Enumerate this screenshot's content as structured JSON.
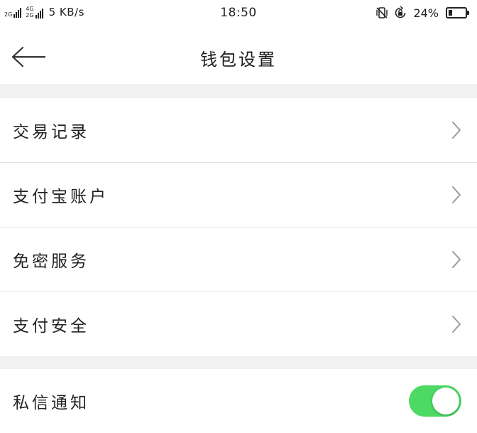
{
  "status_bar": {
    "signal_1_label": "2G",
    "signal_2_label_top": "4G",
    "signal_2_label_bottom": "2G",
    "network_speed": "5 KB/s",
    "time": "18:50",
    "battery_percent": "24%",
    "battery_level": 0.24,
    "icons": [
      "vibrate-off-icon",
      "rotation-lock-icon",
      "battery-icon"
    ]
  },
  "header": {
    "back_icon": "back-arrow-icon",
    "title": "钱包设置"
  },
  "menu_group_1": {
    "items": [
      {
        "label": "交易记录",
        "icon": "chevron-right-icon"
      },
      {
        "label": "支付宝账户",
        "icon": "chevron-right-icon"
      },
      {
        "label": "免密服务",
        "icon": "chevron-right-icon"
      },
      {
        "label": "支付安全",
        "icon": "chevron-right-icon"
      }
    ]
  },
  "menu_group_2": {
    "items": [
      {
        "label": "私信通知",
        "toggle_on": true
      }
    ]
  },
  "colors": {
    "accent_green": "#4cd964",
    "section_gap": "#f1f1f1",
    "divider": "#e2e2e2",
    "chevron": "#9a9a9a"
  }
}
